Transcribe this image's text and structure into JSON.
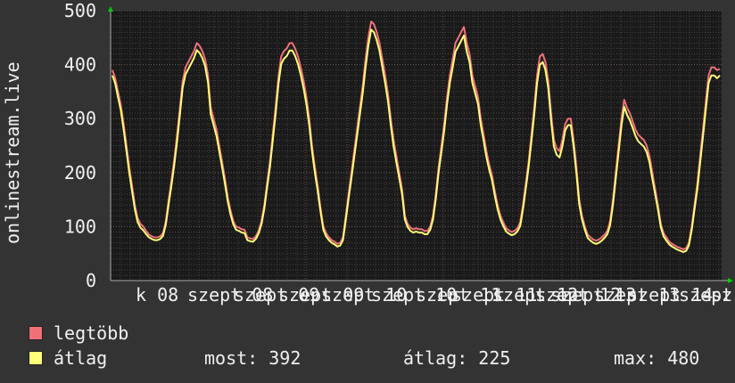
{
  "chart_data": {
    "type": "line",
    "ylabel": "onlinestream.live",
    "ylim": [
      0,
      500
    ],
    "yticks": [
      0,
      100,
      200,
      300,
      400,
      500
    ],
    "xticks": [
      "k 08",
      "szept 08",
      "szept 09",
      "szept 09",
      "szept 10",
      "szept 10",
      "szept 11",
      "szept 11",
      "szept 12",
      "szept 12",
      "szept 13",
      "szept 13",
      "szept 14",
      "szept 14",
      "sz"
    ],
    "grid": true,
    "colors": {
      "legtobb": "#f07078",
      "atlag": "#ffff78",
      "background": "#333333",
      "plot": "#1a1a1a"
    },
    "series": [
      {
        "name": "legtöbb",
        "values": [
          390,
          375,
          350,
          325,
          290,
          250,
          210,
          175,
          140,
          115,
          105,
          100,
          92,
          85,
          82,
          80,
          80,
          82,
          88,
          110,
          150,
          185,
          225,
          270,
          320,
          370,
          395,
          405,
          415,
          425,
          440,
          435,
          425,
          410,
          380,
          320,
          300,
          280,
          250,
          220,
          190,
          155,
          130,
          110,
          100,
          98,
          95,
          94,
          80,
          78,
          77,
          82,
          92,
          110,
          140,
          180,
          220,
          270,
          320,
          375,
          415,
          425,
          430,
          440,
          440,
          430,
          415,
          395,
          370,
          340,
          300,
          250,
          210,
          175,
          135,
          100,
          88,
          80,
          75,
          72,
          68,
          70,
          80,
          120,
          160,
          200,
          240,
          280,
          320,
          360,
          410,
          450,
          480,
          475,
          460,
          440,
          410,
          380,
          345,
          300,
          260,
          230,
          200,
          170,
          120,
          105,
          98,
          95,
          97,
          95,
          95,
          92,
          92,
          100,
          120,
          160,
          210,
          250,
          290,
          340,
          380,
          410,
          440,
          450,
          460,
          470,
          440,
          420,
          380,
          360,
          340,
          300,
          270,
          240,
          215,
          195,
          165,
          140,
          120,
          108,
          97,
          93,
          90,
          92,
          97,
          108,
          140,
          180,
          220,
          270,
          320,
          380,
          415,
          420,
          405,
          370,
          310,
          260,
          245,
          240,
          260,
          290,
          300,
          300,
          260,
          210,
          150,
          120,
          100,
          85,
          80,
          76,
          74,
          76,
          80,
          85,
          92,
          110,
          150,
          200,
          250,
          300,
          335,
          320,
          310,
          295,
          280,
          270,
          265,
          260,
          250,
          230,
          200,
          170,
          140,
          105,
          88,
          80,
          72,
          68,
          65,
          62,
          60,
          58,
          60,
          70,
          100,
          140,
          180,
          230,
          280,
          330,
          380,
          395,
          395,
          390,
          392
        ]
      },
      {
        "name": "átlag",
        "values": [
          380,
          365,
          340,
          315,
          280,
          240,
          200,
          165,
          132,
          108,
          98,
          93,
          86,
          80,
          77,
          75,
          75,
          77,
          83,
          104,
          142,
          176,
          215,
          258,
          308,
          358,
          382,
          392,
          402,
          412,
          427,
          422,
          412,
          397,
          367,
          308,
          288,
          268,
          240,
          210,
          180,
          147,
          123,
          104,
          94,
          92,
          89,
          88,
          75,
          73,
          72,
          77,
          87,
          104,
          133,
          172,
          210,
          258,
          308,
          362,
          401,
          411,
          416,
          426,
          426,
          416,
          401,
          381,
          356,
          327,
          288,
          240,
          200,
          166,
          128,
          94,
          82,
          75,
          70,
          67,
          63,
          65,
          75,
          113,
          152,
          190,
          229,
          268,
          307,
          347,
          395,
          435,
          465,
          460,
          445,
          425,
          395,
          366,
          332,
          288,
          248,
          219,
          190,
          161,
          113,
          99,
          92,
          89,
          91,
          89,
          89,
          86,
          86,
          94,
          113,
          152,
          200,
          239,
          278,
          327,
          366,
          395,
          424,
          434,
          444,
          454,
          424,
          405,
          366,
          347,
          327,
          288,
          259,
          229,
          205,
          186,
          157,
          132,
          113,
          101,
          91,
          87,
          84,
          86,
          91,
          101,
          132,
          171,
          210,
          259,
          308,
          366,
          400,
          405,
          390,
          356,
          297,
          248,
          233,
          228,
          248,
          278,
          288,
          288,
          248,
          199,
          141,
          113,
          94,
          79,
          74,
          70,
          68,
          70,
          74,
          79,
          86,
          103,
          141,
          189,
          238,
          287,
          322,
          307,
          297,
          283,
          268,
          258,
          253,
          248,
          238,
          219,
          189,
          160,
          132,
          99,
          82,
          74,
          67,
          63,
          60,
          57,
          55,
          53,
          55,
          65,
          94,
          132,
          170,
          218,
          267,
          316,
          366,
          380,
          380,
          375,
          380
        ]
      }
    ]
  },
  "legend": [
    {
      "label": "legtöbb",
      "color": "#f07078"
    },
    {
      "label": "átlag",
      "color": "#ffff78"
    }
  ],
  "stats": {
    "most": "most: 392",
    "atlag": "átlag: 225",
    "max": "max: 480"
  }
}
